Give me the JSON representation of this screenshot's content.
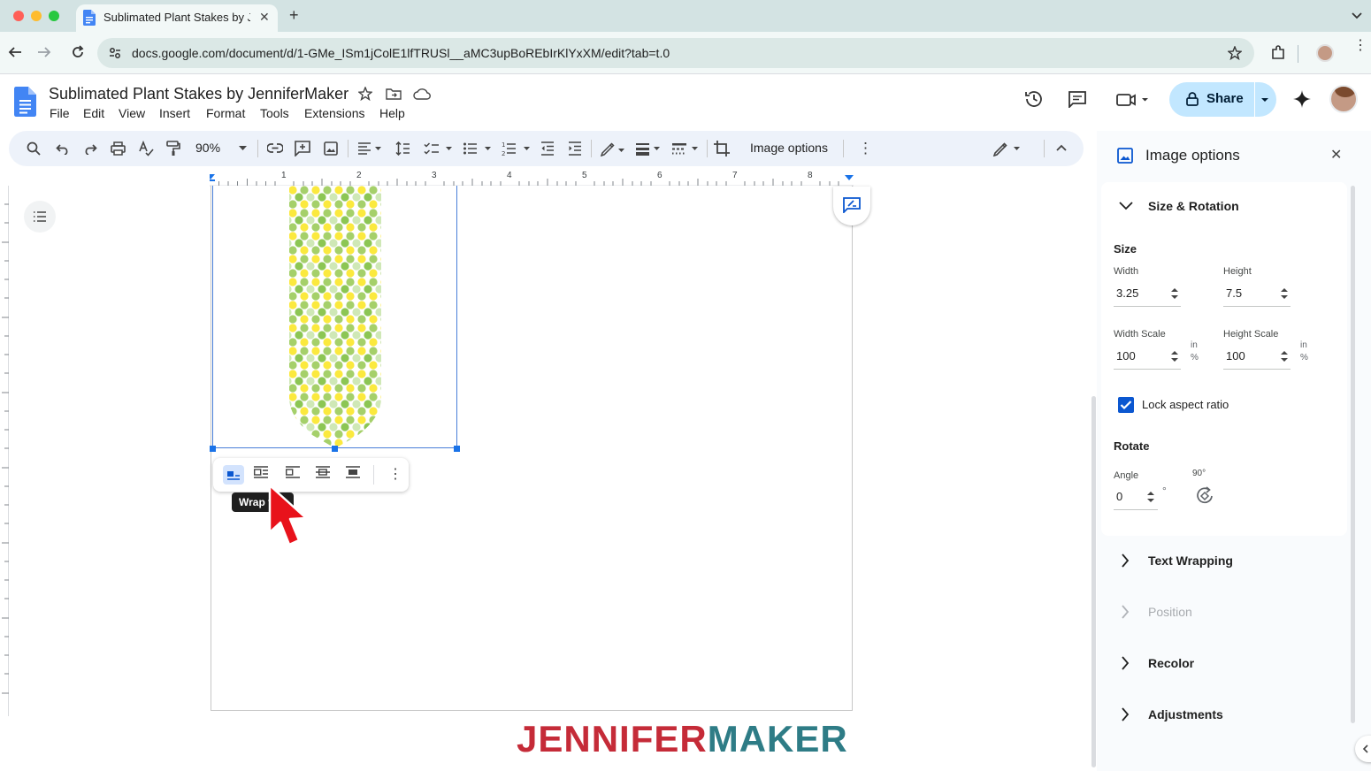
{
  "browser": {
    "tab_title": "Sublimated Plant Stakes by J",
    "url": "docs.google.com/document/d/1-GMe_ISm1jColE1lfTRUSl__aMC3upBoREbIrKlYxXM/edit?tab=t.0"
  },
  "doc": {
    "title": "Sublimated Plant Stakes by JenniferMaker",
    "menu": [
      "File",
      "Edit",
      "View",
      "Insert",
      "Format",
      "Tools",
      "Extensions",
      "Help"
    ],
    "share_label": "Share"
  },
  "toolbar": {
    "zoom": "90%",
    "image_options_label": "Image options"
  },
  "ruler": {
    "numbers": [
      "1",
      "2",
      "3",
      "4",
      "5",
      "6",
      "7",
      "8"
    ]
  },
  "canvas": {
    "tooltip": "Wrap t",
    "logo_part1": "JENNIFER",
    "logo_part2": "MAKER"
  },
  "panel": {
    "title": "Image options",
    "size_rotation": {
      "title": "Size & Rotation",
      "size_label": "Size",
      "width_label": "Width",
      "width_value": "3.25",
      "width_unit": "in",
      "height_label": "Height",
      "height_value": "7.5",
      "height_unit": "in",
      "width_scale_label": "Width Scale",
      "width_scale_value": "100",
      "height_scale_label": "Height Scale",
      "height_scale_value": "100",
      "percent": "%",
      "lock_label": "Lock aspect ratio",
      "lock_checked": true,
      "rotate_label": "Rotate",
      "angle_label": "Angle",
      "angle_value": "0",
      "degree": "°",
      "rotate90_label": "90°"
    },
    "sections": {
      "text_wrapping": "Text Wrapping",
      "position": "Position",
      "recolor": "Recolor",
      "adjustments": "Adjustments"
    }
  },
  "colors": {
    "accent": "#0b57d0",
    "share_bg": "#c2e7ff",
    "logo_red": "#c52b38",
    "logo_teal": "#2e7c86",
    "cursor_red": "#e8121b"
  }
}
